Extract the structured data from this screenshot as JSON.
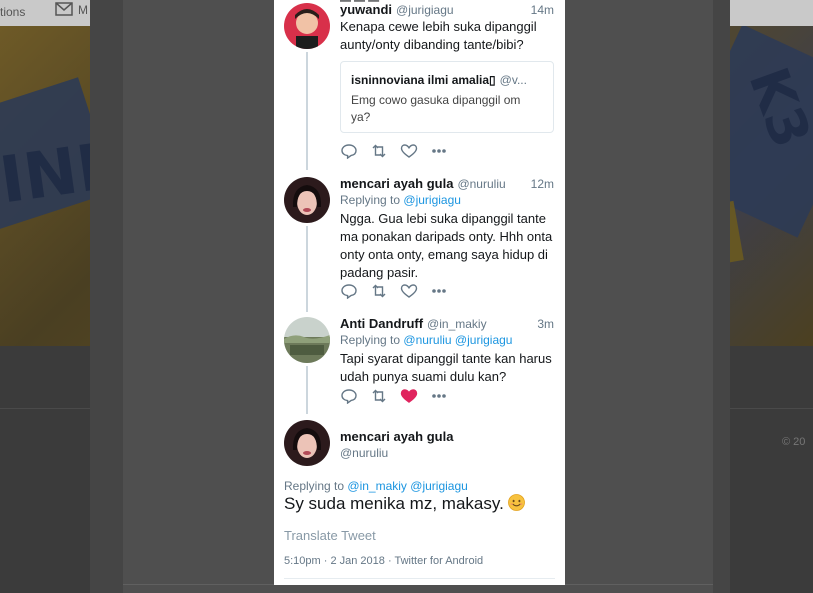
{
  "background": {
    "nav_left": "tions",
    "nav_m": "M",
    "copyright": "© 20"
  },
  "thread": {
    "top_cut_text": "— — —",
    "tweets": [
      {
        "name": "yuwandi",
        "handle": "@jurigiagu",
        "time": "14m",
        "text": "Kenapa cewe lebih suka dipanggil aunty/onty dibanding tante/bibi?",
        "quote": {
          "name": "isninnoviana ilmi amalia▯",
          "handle": "@v...",
          "text": "Emg cowo gasuka dipanggil om ya?"
        }
      },
      {
        "name": "mencari ayah gula",
        "handle": "@nuruliu",
        "time": "12m",
        "replying_label": "Replying to",
        "replying_mentions": "@jurigiagu",
        "text": "Ngga. Gua lebi suka dipanggil tante ma ponakan daripads onty. Hhh onta onty onta onty, emang saya hidup di padang pasir."
      },
      {
        "name": "Anti Dandruff",
        "handle": "@in_makiy",
        "time": "3m",
        "replying_label": "Replying to",
        "replying_mentions": "@nuruliu @jurigiagu",
        "text": "Tapi syarat dipanggil tante kan harus udah punya suami dulu kan?",
        "liked": true
      }
    ],
    "main": {
      "name": "mencari ayah gula",
      "handle": "@nuruliu",
      "replying_label": "Replying to",
      "replying_mentions": "@in_makiy @jurigiagu",
      "text": "Sy suda menika mz, makasy.",
      "translate": "Translate Tweet",
      "meta": "5:10pm · 2 Jan 2018 · Twitter for Android"
    }
  },
  "colors": {
    "link": "#1b95e0",
    "muted": "#657786",
    "like": "#e0245e",
    "text": "#14171a"
  },
  "icons": {
    "reply": "reply-icon",
    "retweet": "retweet-icon",
    "like": "heart-icon",
    "more": "more-icon",
    "emoji": "smiling-face-emoji-icon",
    "mail": "mail-icon"
  }
}
